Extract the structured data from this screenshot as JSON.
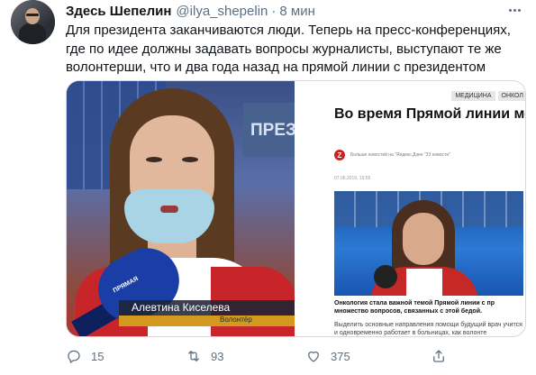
{
  "tweet": {
    "display_name": "Здесь Шепелин",
    "handle": "@ilya_shepelin",
    "separator": "·",
    "time": "8 мин",
    "text": "Для президента заканчиваются люди. Теперь на пресс-конференциях, где по идее должны задавать вопросы журналисты, выступают те же волонтерши, что и два года назад на прямой линии с президентом"
  },
  "media": {
    "left_frame": {
      "background_sign": "ПРЕЗ",
      "mic_brand": "ПРЯМАЯ",
      "lower_third_name": "Алевтина Киселева",
      "lower_third_role": "Волонтёр"
    },
    "right_frame": {
      "tags": [
        "МЕДИЦИНА",
        "ОНКОЛ"
      ],
      "title": "Во время Прямой линии мо рассказала президенту о ж",
      "source_badge": "Z",
      "source_text": "Больше новостей на \"Яндекс.Дзен \"33 новости\"",
      "date": "07.06.2019, 15:55",
      "caption": "Онкология стала важной темой Прямой линии с пр множество вопросов, связанных с этой бедой.",
      "body": "Выделить основные направления помощи будущий врач учится и одновременно работает в больницах, как волонте"
    }
  },
  "actions": {
    "reply_count": "15",
    "retweet_count": "93",
    "like_count": "375"
  },
  "icons": {
    "reply": "reply-icon",
    "retweet": "retweet-icon",
    "like": "like-icon",
    "share": "share-icon",
    "more": "more-icon"
  },
  "colors": {
    "text": "#0f1419",
    "secondary": "#5b7083",
    "border": "#cfd9de"
  }
}
